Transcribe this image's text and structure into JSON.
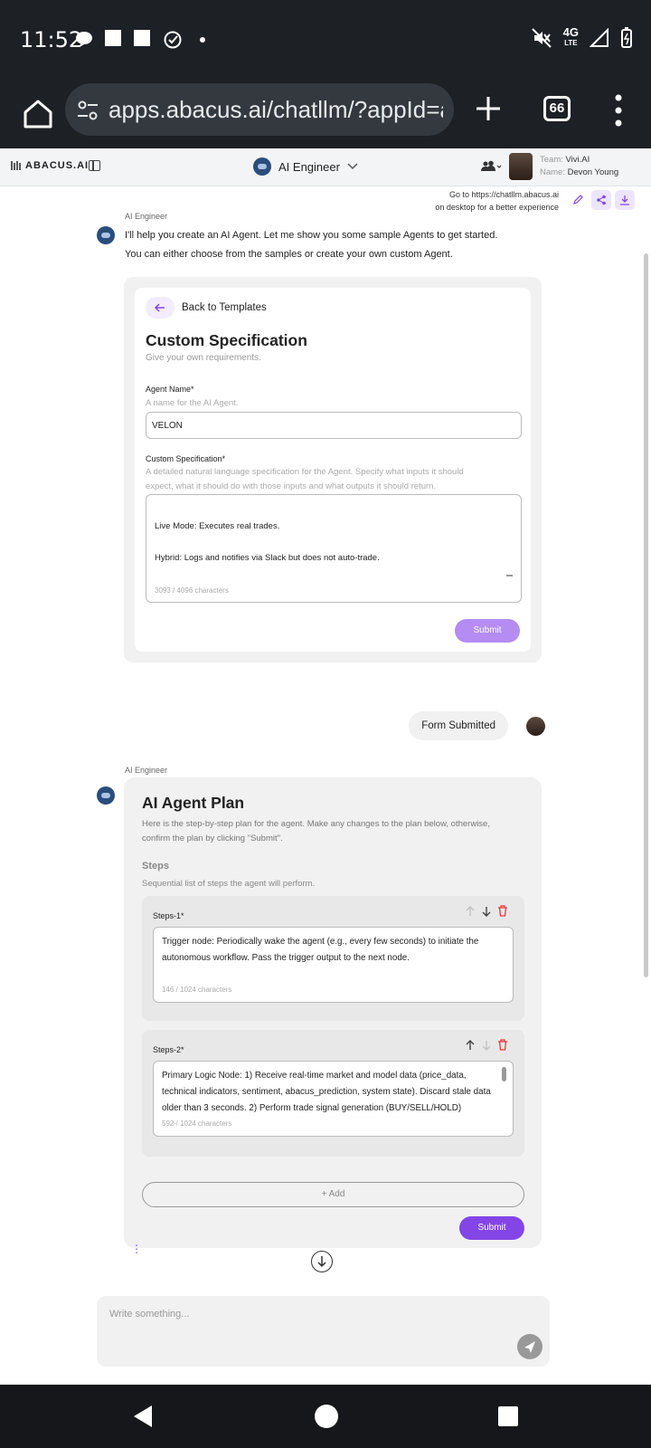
{
  "status_bar": {
    "time": "11:52",
    "network": "4G",
    "network_sub": "LTE",
    "icons": [
      "chat-bubble-icon",
      "square-notification-icon",
      "square-notification-icon",
      "check-circle-icon",
      "dot-icon",
      "muted-icon",
      "signal-icon",
      "battery-icon"
    ]
  },
  "browser": {
    "url": "apps.abacus.ai/chatllm/?appId=ai_",
    "tab_count": "66"
  },
  "app_header": {
    "logo_text": "ABACUS.AI",
    "agent_name": "AI Engineer",
    "team_label": "Team:",
    "team_value": "Vivi.AI",
    "name_label": "Name:",
    "name_value": "Devon Young"
  },
  "desktop_note": {
    "line1": "Go to https://chatllm.abacus.ai",
    "line2": "on desktop for a better experience"
  },
  "message1": {
    "sender": "AI Engineer",
    "line1": "I'll help you create an AI Agent. Let me show you some sample Agents to get started.",
    "line2": "You can either choose from the samples or create your own custom Agent."
  },
  "spec_form": {
    "back_label": "Back to Templates",
    "title": "Custom Specification",
    "subtitle": "Give your own requirements.",
    "agent_name_label": "Agent Name*",
    "agent_name_help": "A name for the AI Agent.",
    "agent_name_value": "VELON",
    "custom_spec_label": "Custom Specification*",
    "custom_spec_help_line1": "A detailed natural language specification for the Agent. Specify what inputs it should",
    "custom_spec_help_line2": "expect, what it should do with those inputs and what outputs it should return.",
    "spec_line1": "Live Mode: Executes real trades.",
    "spec_line2": "Hybrid: Logs and notifies via Slack but does not auto-trade.",
    "char_count": "3093 / 4096 characters",
    "submit_label": "Submit"
  },
  "user_message": {
    "text": "Form Submitted"
  },
  "plan": {
    "sender": "AI Engineer",
    "title": "AI Agent Plan",
    "desc_line1": "Here is the step-by-step plan for the agent. Make any changes to the plan below, otherwise,",
    "desc_line2": "confirm the plan by clicking \"Submit\".",
    "steps_heading": "Steps",
    "steps_sub": "Sequential list of steps the agent will perform.",
    "steps": [
      {
        "label": "Steps-1*",
        "text": "Trigger node: Periodically wake the agent (e.g., every few seconds) to initiate the autonomous workflow. Pass the trigger output to the next node.",
        "char_count": "146 / 1024 characters"
      },
      {
        "label": "Steps-2*",
        "text": "Primary Logic Node: 1) Receive real-time market and model data (price_data, technical indicators, sentiment, abacus_prediction, system state). Discard stale data older than 3 seconds. 2) Perform trade signal generation (BUY/SELL/HOLD)",
        "char_count": "592 / 1024 characters"
      }
    ],
    "add_label": "+ Add",
    "submit_label": "Submit"
  },
  "composer": {
    "placeholder": "Write something..."
  },
  "colors": {
    "accent": "#8445e6",
    "accent_light": "#b48cf2",
    "delete": "#e53935",
    "system_bar": "#1d2126"
  }
}
